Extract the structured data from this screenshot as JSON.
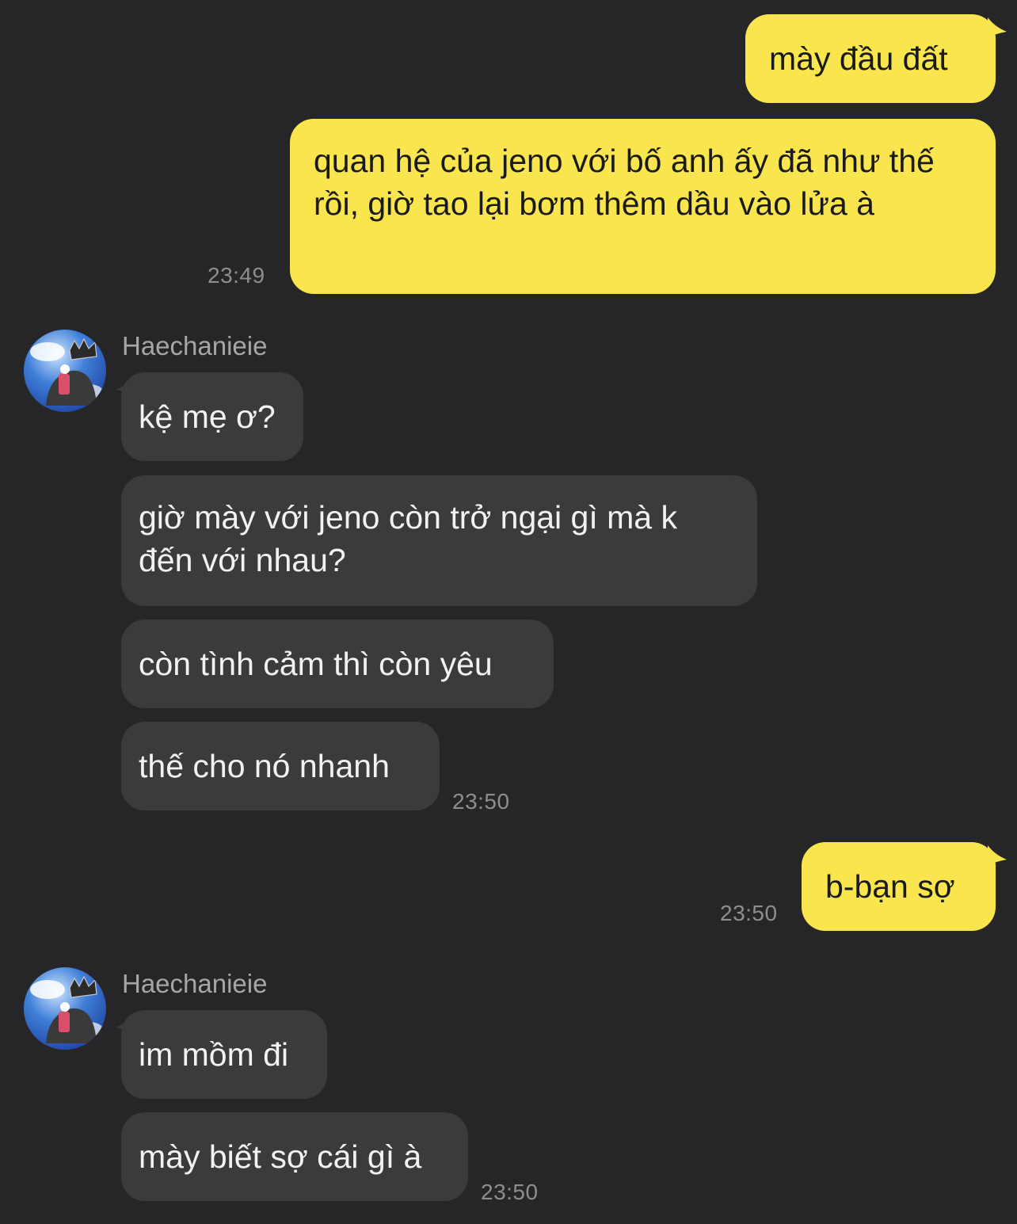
{
  "conversation": {
    "messages": [
      {
        "from": "me",
        "text": "mày đầu đất"
      },
      {
        "from": "me",
        "text": "quan hệ của jeno với bố anh ấy đã như thế rồi, giờ tao lại bơm thêm dầu vào lửa à",
        "time": "23:49"
      },
      {
        "from": "Haechanieie",
        "text": "kệ mẹ ơ?"
      },
      {
        "from": "Haechanieie",
        "text": "giờ mày với jeno còn trở ngại gì mà k đến với nhau?"
      },
      {
        "from": "Haechanieie",
        "text": "còn tình cảm thì còn yêu"
      },
      {
        "from": "Haechanieie",
        "text": "thế cho nó nhanh",
        "time": "23:50"
      },
      {
        "from": "me",
        "text": "b-bạn sợ",
        "time": "23:50"
      },
      {
        "from": "Haechanieie",
        "text": "im mồm đi"
      },
      {
        "from": "Haechanieie",
        "text": "mày biết sợ cái gì à",
        "time": "23:50"
      }
    ],
    "groups": [
      {
        "sender": "Haechanieie"
      },
      {
        "sender": "Haechanieie"
      }
    ]
  },
  "colors": {
    "background": "#262628",
    "outgoing_bubble": "#f9e54d",
    "incoming_bubble": "#3b3b3d",
    "timestamp": "#8e8e90"
  },
  "icons": {
    "avatar": "profile-photo-crown-sky"
  }
}
